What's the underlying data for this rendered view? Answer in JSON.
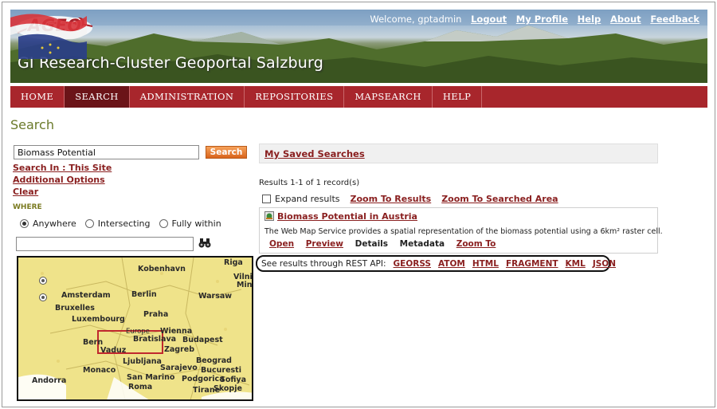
{
  "header": {
    "logo_text": "AGEO",
    "site_title": "GI Research-Cluster Geoportal Salzburg",
    "welcome": "Welcome, gptadmin",
    "links": [
      "Logout",
      "My Profile",
      "Help",
      "About",
      "Feedback"
    ]
  },
  "nav": {
    "items": [
      "HOME",
      "SEARCH",
      "ADMINISTRATION",
      "REPOSITORIES",
      "MAPSEARCH",
      "HELP"
    ],
    "active": "SEARCH"
  },
  "page_title": "Search",
  "search": {
    "value": "Biomass Potential",
    "button": "Search",
    "search_in": "Search In : This Site",
    "additional_options": "Additional Options",
    "clear": "Clear"
  },
  "where": {
    "label": "WHERE",
    "options": [
      "Anywhere",
      "Intersecting",
      "Fully within"
    ],
    "selected": "Anywhere",
    "place_value": ""
  },
  "map": {
    "cities": [
      "Riga",
      "Kobenhavn",
      "Vilnius",
      "Minsk",
      "Amsterdam",
      "Berlin",
      "Warsaw",
      "Bruxelles",
      "Luxembourg",
      "Praha",
      "Europe",
      "Wienna",
      "Bratislava",
      "Budapest",
      "Bern",
      "Vaduz",
      "Zagreb",
      "Ljubljana",
      "Beograd",
      "Bucuresti",
      "Sarajevo",
      "Monaco",
      "San Marino",
      "Podgorica",
      "Sofiya",
      "Roma",
      "Tirane",
      "Skopje",
      "Andorra"
    ]
  },
  "results": {
    "saved_searches": "My Saved Searches",
    "count": "Results 1-1 of 1 record(s)",
    "expand_label": "Expand results",
    "zoom_results": "Zoom To Results",
    "zoom_area": "Zoom To Searched Area",
    "record": {
      "title": "Biomass Potential in Austria",
      "description": "The Web Map Service provides a spatial representation of the biomass potential using a 6km² raster cell.",
      "actions": [
        "Open",
        "Preview",
        "Details",
        "Metadata",
        "Zoom To"
      ]
    },
    "rest_label": "See results through REST API:",
    "rest_links": [
      "GEORSS",
      "ATOM",
      "HTML",
      "FRAGMENT",
      "KML",
      "JSON"
    ]
  },
  "colors": {
    "nav_bg": "#a8262c",
    "nav_active": "#6b1418",
    "link": "#8a2020",
    "title_green": "#6b7a2a",
    "button_orange": "#e57a2e",
    "map_yellow": "#efe38a"
  }
}
